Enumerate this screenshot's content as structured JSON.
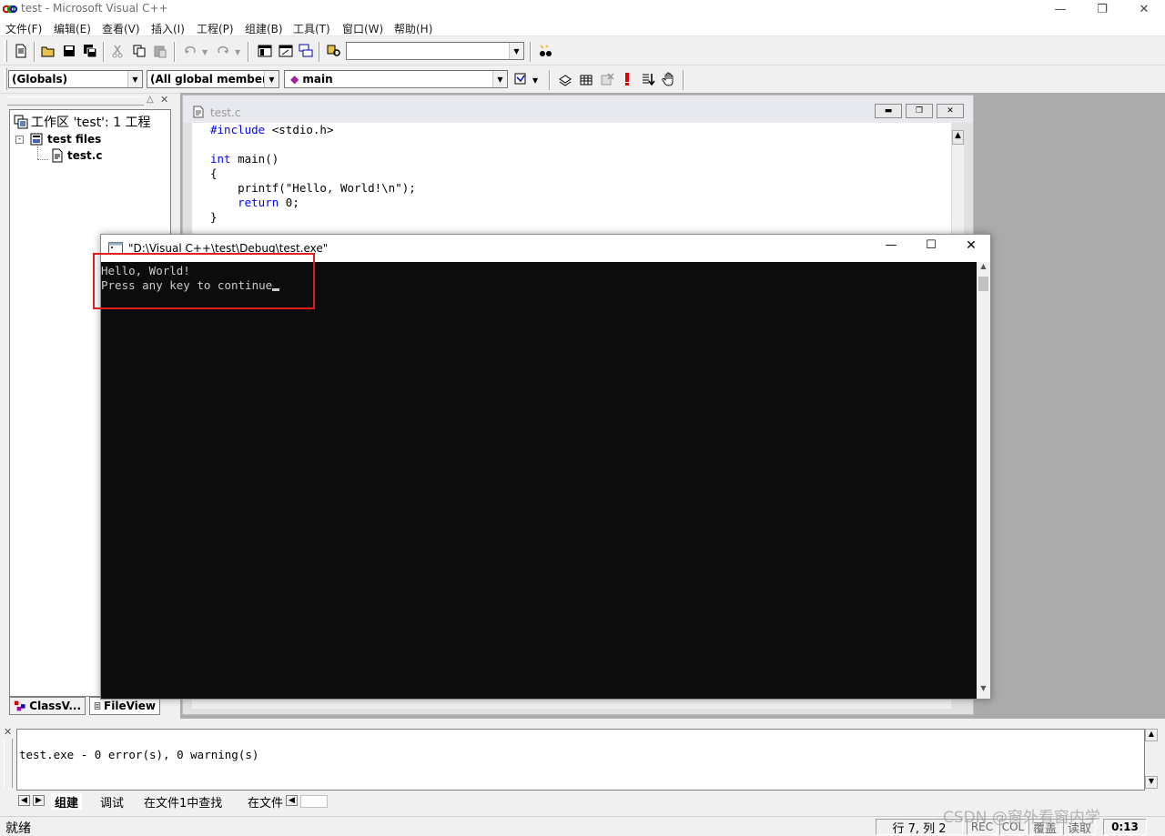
{
  "window": {
    "title": "test - Microsoft Visual C++"
  },
  "menubar": {
    "items": [
      "文件(F)",
      "编辑(E)",
      "查看(V)",
      "插入(I)",
      "工程(P)",
      "组建(B)",
      "工具(T)",
      "窗口(W)",
      "帮助(H)"
    ]
  },
  "toolbar2": {
    "globals_combo": "(Globals)",
    "members_combo": "(All global members",
    "function_combo": "main"
  },
  "workspace": {
    "root": "工作区 'test': 1 工程",
    "folder": "test files",
    "file": "test.c",
    "tabs": [
      "ClassV...",
      "FileView"
    ]
  },
  "editor": {
    "title": "test.c",
    "code": [
      {
        "kw": "#include",
        "rest": " <stdio.h>"
      },
      {
        "kw": "",
        "rest": ""
      },
      {
        "kw": "int",
        "rest": " main()"
      },
      {
        "kw": "",
        "rest": "{"
      },
      {
        "kw": "",
        "rest": "    printf(\"Hello, World!\\n\");"
      },
      {
        "kw": "    return",
        "rest": " 0;"
      },
      {
        "kw": "",
        "rest": "}"
      }
    ]
  },
  "console": {
    "title": "\"D:\\Visual C++\\test\\Debug\\test.exe\"",
    "lines": [
      "Hello, World!",
      "Press any key to continue"
    ]
  },
  "output": {
    "text": "test.exe - 0 error(s), 0 warning(s)",
    "tabs": [
      "组建",
      "调试",
      "在文件1中查找",
      "在文件"
    ]
  },
  "statusbar": {
    "ready": "就绪",
    "position": "行 7, 列 2",
    "rec": "REC",
    "col": "COL",
    "ovr": "覆盖",
    "read": "读取",
    "time": "0:13"
  },
  "watermark": "CSDN @窗外看窗内学",
  "colors": {
    "highlight_box": "#e01e1e",
    "keyword": "#0000ff",
    "console_bg": "#0c0c0c"
  }
}
